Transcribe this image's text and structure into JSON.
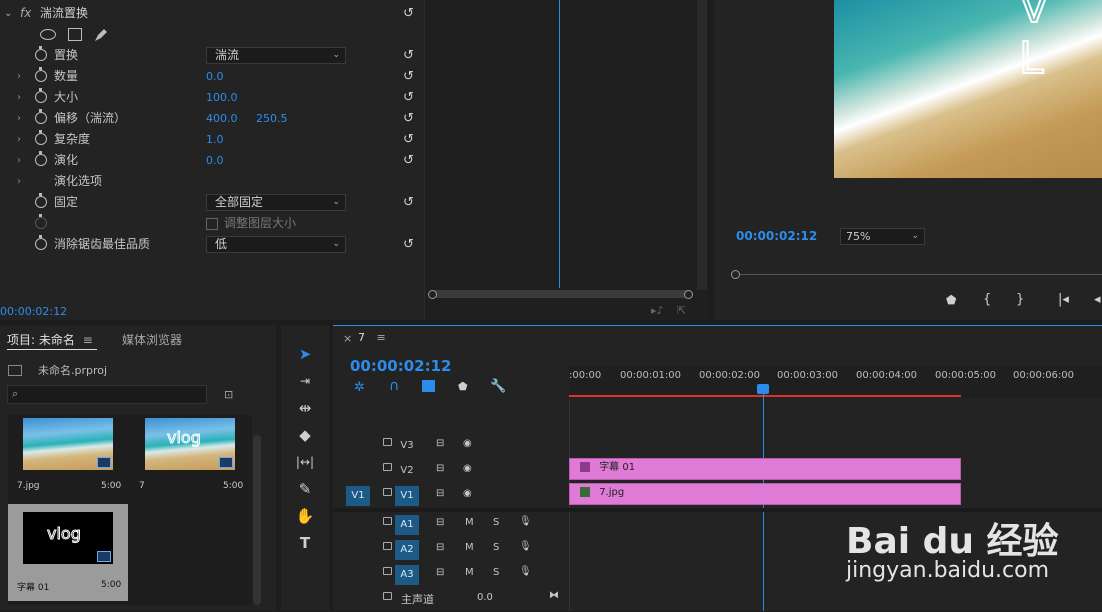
{
  "effect_controls": {
    "effect_name": "湍流置换",
    "fx_badge": "fx",
    "rows": [
      {
        "label": "置换",
        "dropdown": "湍流"
      },
      {
        "label": "数量",
        "value": "0.0"
      },
      {
        "label": "大小",
        "value": "100.0"
      },
      {
        "label": "偏移（湍流）",
        "value": "400.0",
        "value2": "250.5"
      },
      {
        "label": "复杂度",
        "value": "1.0"
      },
      {
        "label": "演化",
        "value": "0.0"
      },
      {
        "label": "演化选项"
      },
      {
        "label": "固定",
        "dropdown": "全部固定"
      },
      {
        "label": "调整图层大小"
      },
      {
        "label": "消除锯齿最佳品质",
        "dropdown": "低"
      }
    ],
    "timecode": "00:00:02:12",
    "reset_glyph": "↺"
  },
  "program_monitor": {
    "timecode": "00:00:02:12",
    "zoom": "75%",
    "video_overlay_text": "V L"
  },
  "project": {
    "tab_label": "项目: 未命名",
    "media_browser_tab": "媒体浏览器",
    "project_file": "未命名.prproj",
    "items": [
      {
        "name": "7.jpg",
        "duration": "5:00"
      },
      {
        "name": "7",
        "duration": "5:00",
        "overlay": "vlog"
      },
      {
        "name": "字幕 01",
        "duration": "5:00",
        "overlay": "vlog"
      }
    ]
  },
  "timeline": {
    "sequence_name": "7",
    "timecode": "00:00:02:12",
    "ruler": [
      ":00:00",
      "00:00:01:00",
      "00:00:02:00",
      "00:00:03:00",
      "00:00:04:00",
      "00:00:05:00",
      "00:00:06:00"
    ],
    "video_tracks": [
      "V3",
      "V2",
      "V1"
    ],
    "audio_tracks": [
      "A1",
      "A2",
      "A3"
    ],
    "source_patch": "V1",
    "master_label": "主声道",
    "master_value": "0.0",
    "mute": "M",
    "solo": "S",
    "clips": [
      {
        "track": "V2",
        "label": "字幕 01"
      },
      {
        "track": "V1",
        "label": "7.jpg"
      }
    ]
  },
  "watermark": {
    "brand": "Bai du 经验",
    "url": "jingyan.baidu.com"
  }
}
